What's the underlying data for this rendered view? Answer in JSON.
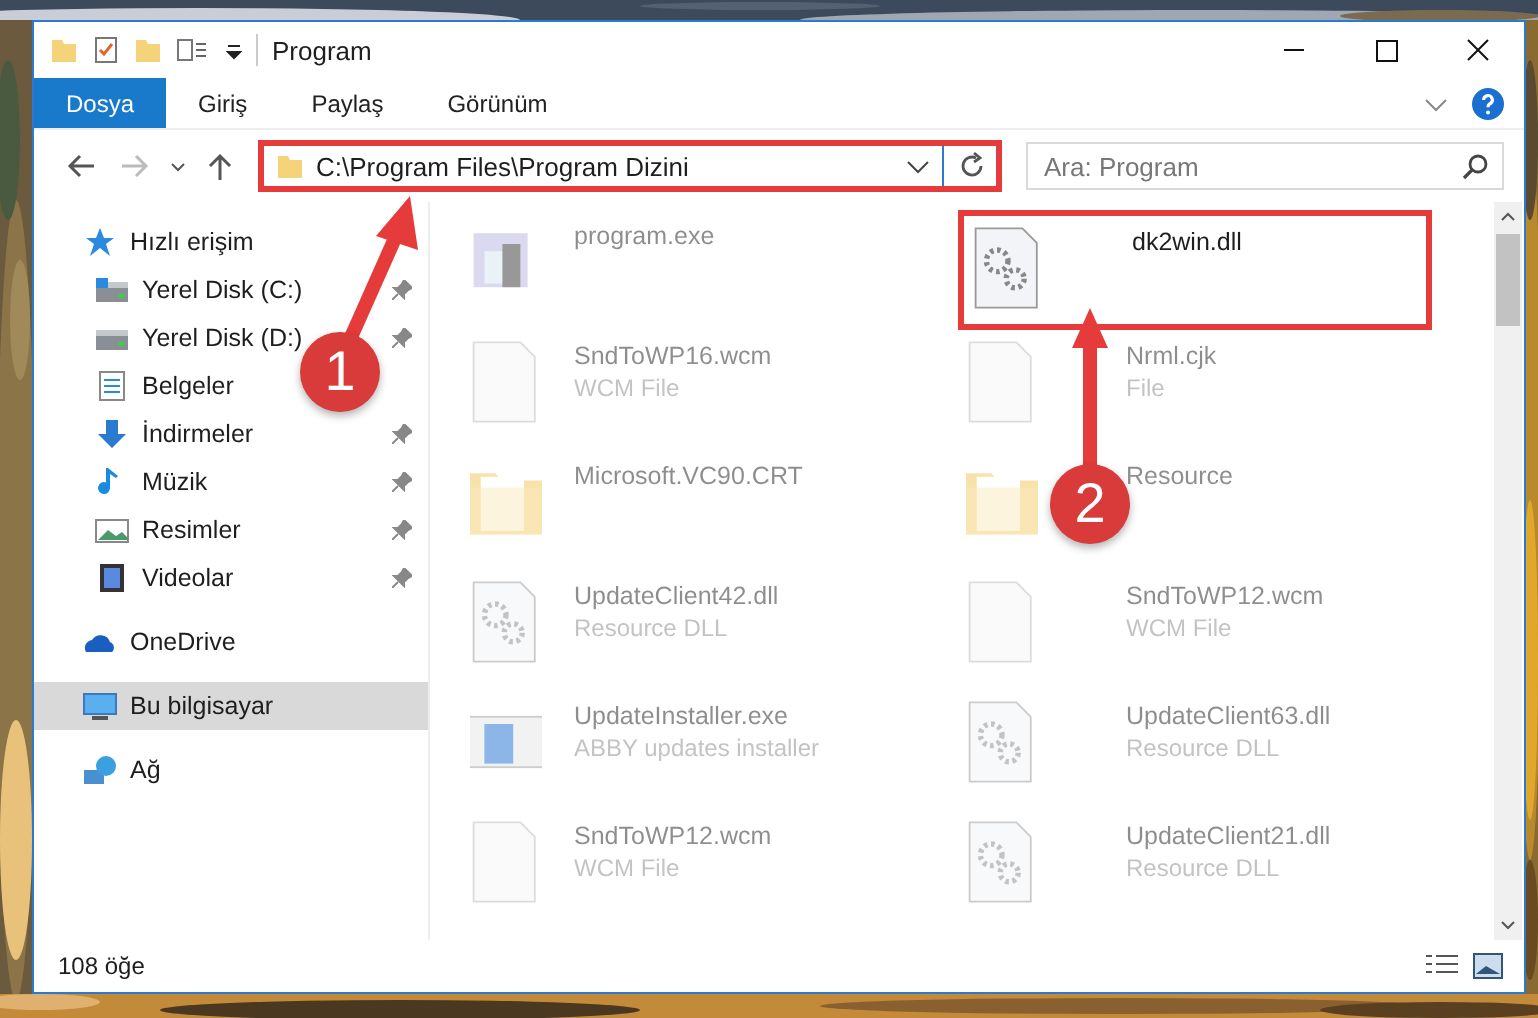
{
  "window": {
    "title": "Program"
  },
  "ribbon": {
    "tabs": [
      {
        "label": "Dosya",
        "selected": true
      },
      {
        "label": "Giriş",
        "selected": false
      },
      {
        "label": "Paylaş",
        "selected": false
      },
      {
        "label": "Görünüm",
        "selected": false
      }
    ]
  },
  "address_bar": {
    "path": "C:\\Program Files\\Program Dizini",
    "highlighted": true
  },
  "search": {
    "placeholder": "Ara: Program"
  },
  "sidebar": {
    "items": [
      {
        "label": "Hızlı erişim",
        "kind": "quick",
        "selected": false,
        "children": [
          {
            "label": "Yerel Disk (C:)",
            "kind": "drive-c",
            "pinned": true
          },
          {
            "label": "Yerel Disk (D:)",
            "kind": "drive",
            "pinned": true
          },
          {
            "label": "Belgeler",
            "kind": "documents",
            "pinned": false
          },
          {
            "label": "İndirmeler",
            "kind": "downloads",
            "pinned": true
          },
          {
            "label": "Müzik",
            "kind": "music",
            "pinned": true
          },
          {
            "label": "Resimler",
            "kind": "pictures",
            "pinned": true
          },
          {
            "label": "Videolar",
            "kind": "videos",
            "pinned": true
          }
        ]
      },
      {
        "label": "OneDrive",
        "kind": "cloud",
        "selected": false
      },
      {
        "label": "Bu bilgisayar",
        "kind": "computer",
        "selected": true
      },
      {
        "label": "Ağ",
        "kind": "network",
        "selected": false
      }
    ]
  },
  "files": [
    {
      "name": "program.exe",
      "kind": "exe",
      "blurred": true,
      "highlighted": false
    },
    {
      "name": "dk2win.dll",
      "kind": "dll",
      "blurred": false,
      "highlighted": true
    },
    {
      "name": "SndToWP16.wcm",
      "type": "WCM File",
      "kind": "file",
      "blurred": true,
      "highlighted": false
    },
    {
      "name": "Nrml.cjk",
      "type": "File",
      "kind": "file",
      "blurred": true,
      "highlighted": false
    },
    {
      "name": "Microsoft.VC90.CRT",
      "kind": "folder",
      "blurred": true,
      "highlighted": false
    },
    {
      "name": "Resource",
      "kind": "folder",
      "blurred": true,
      "highlighted": false
    },
    {
      "name": "UpdateClient42.dll",
      "type": "Resource DLL",
      "kind": "dll",
      "blurred": true,
      "highlighted": false
    },
    {
      "name": "SndToWP12.wcm",
      "type": "WCM File",
      "kind": "file",
      "blurred": true,
      "highlighted": false
    },
    {
      "name": "UpdateInstaller.exe",
      "type": "ABBY updates installer",
      "kind": "installer",
      "blurred": true,
      "highlighted": false
    },
    {
      "name": "UpdateClient63.dll",
      "type": "Resource DLL",
      "kind": "dll",
      "blurred": true,
      "highlighted": false
    },
    {
      "name": "SndToWP12.wcm",
      "type": "WCM File",
      "kind": "file",
      "blurred": true,
      "highlighted": false
    },
    {
      "name": "UpdateClient21.dll",
      "type": "Resource DLL",
      "kind": "dll",
      "blurred": true,
      "highlighted": false
    }
  ],
  "status_bar": {
    "count": "108 öğe"
  },
  "annotations": [
    {
      "number": "1"
    },
    {
      "number": "2"
    }
  ]
}
